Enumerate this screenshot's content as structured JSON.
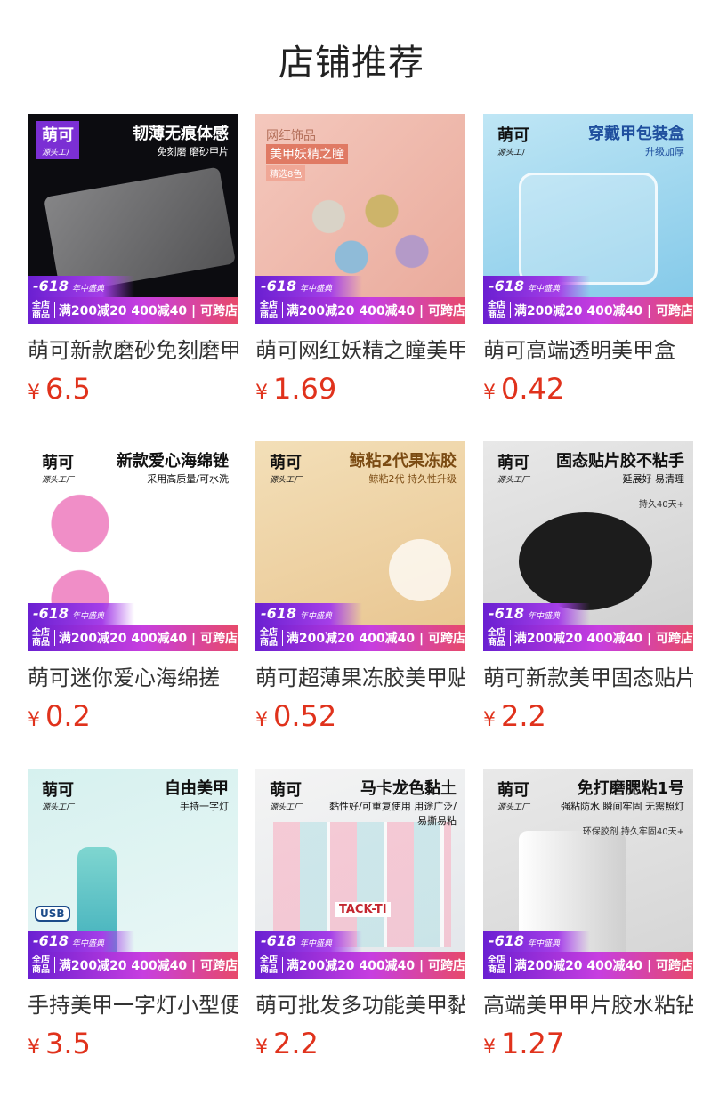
{
  "page_title": "店铺推荐",
  "promo": {
    "event": "-618",
    "event_sub": "年中盛典",
    "tag": "全店商品",
    "text": "满200减20 400减40 | 可跨店"
  },
  "products": [
    {
      "name": "萌可新款磨砂免刻磨甲片",
      "price_symbol": "¥",
      "price": "6.5",
      "brand": "萌可",
      "brand_sub": "源头工厂",
      "headline": "韧薄无痕体感",
      "sub": "免刻磨 磨砂甲片"
    },
    {
      "name": "萌可网红妖精之瞳美甲亮片",
      "price_symbol": "¥",
      "price": "1.69",
      "brand": "",
      "brand_sub": "",
      "headline": "网红饰品",
      "sub": "美甲妖精之瞳",
      "extra": "精选8色"
    },
    {
      "name": "萌可高端透明美甲盒",
      "price_symbol": "¥",
      "price": "0.42",
      "brand": "萌可",
      "brand_sub": "源头工厂",
      "headline": "穿戴甲包装盒",
      "sub": "升级加厚"
    },
    {
      "name": "萌可迷你爱心海绵搓",
      "price_symbol": "¥",
      "price": "0.2",
      "brand": "萌可",
      "brand_sub": "源头工厂",
      "headline": "新款爱心海绵锉",
      "sub": "采用高质量/可水洗"
    },
    {
      "name": "萌可超薄果冻胶美甲贴",
      "price_symbol": "¥",
      "price": "0.52",
      "brand": "萌可",
      "brand_sub": "源头工厂",
      "headline": "鲸粘2代果冻胶",
      "sub": "鲸粘2代 持久性升级"
    },
    {
      "name": "萌可新款美甲固态贴片胶",
      "price_symbol": "¥",
      "price": "2.2",
      "brand": "萌可",
      "brand_sub": "源头工厂",
      "headline": "固态贴片胶不粘手",
      "sub": "延展好 易清理",
      "extra": "持久40天+"
    },
    {
      "name": "手持美甲一字灯小型便携",
      "price_symbol": "¥",
      "price": "3.5",
      "brand": "萌可",
      "brand_sub": "源头工厂",
      "headline": "自由美甲",
      "sub": "手持一字灯",
      "extra": "USB"
    },
    {
      "name": "萌可批发多功能美甲黏土",
      "price_symbol": "¥",
      "price": "2.2",
      "brand": "萌可",
      "brand_sub": "源头工厂",
      "headline": "马卡龙色黏土",
      "sub": "黏性好/可重复使用 用途广泛/易撕易粘",
      "extra": "TACK-TI"
    },
    {
      "name": "高端美甲甲片胶水粘钻",
      "price_symbol": "¥",
      "price": "1.27",
      "brand": "萌可",
      "brand_sub": "源头工厂",
      "headline": "免打磨腮粘1号",
      "sub": "强粘防水 瞬间牢固 无需照灯",
      "extra": "环保胶剂 持久牢固40天+"
    }
  ]
}
